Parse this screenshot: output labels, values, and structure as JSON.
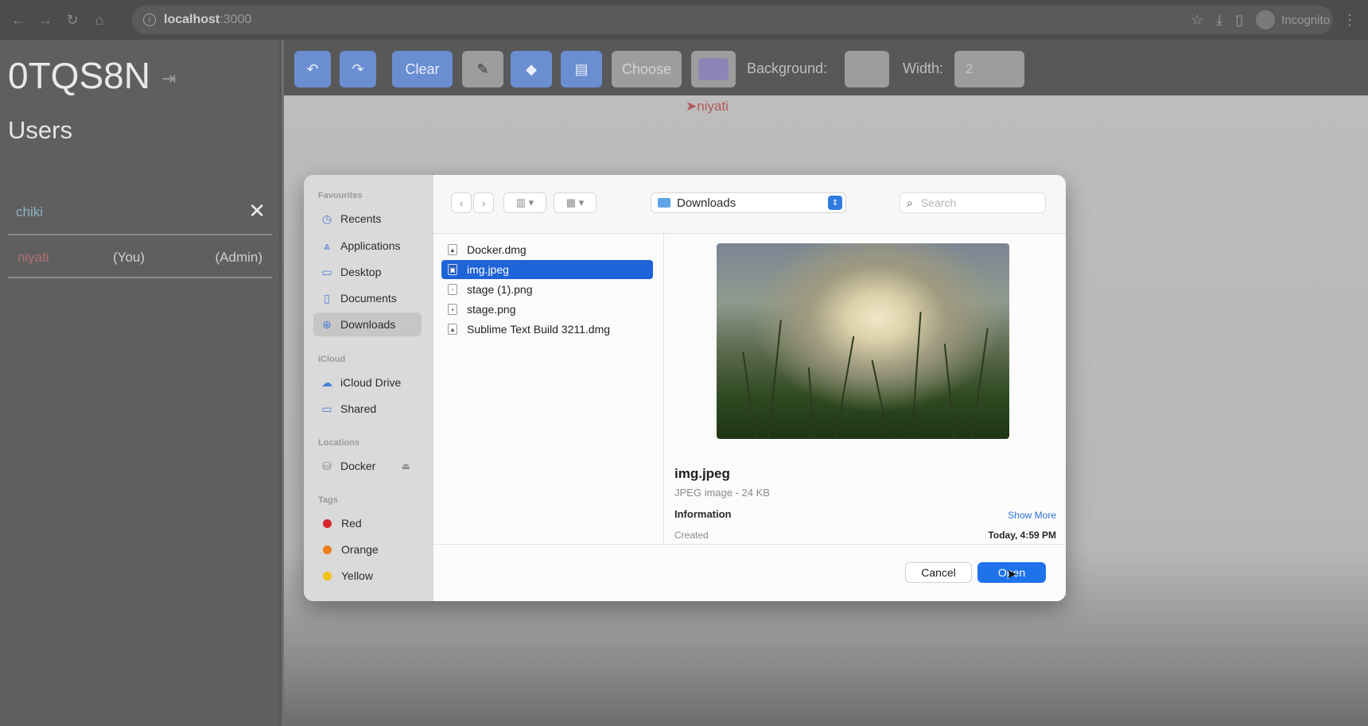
{
  "browser": {
    "host": "localhost",
    "port": ":3000",
    "profile_label": "Incognito"
  },
  "sidebar": {
    "room_code": "0TQS8N",
    "users_title": "Users",
    "search_value": "chiki",
    "users": [
      {
        "name": "niyati",
        "you": "(You)",
        "role": "(Admin)"
      }
    ]
  },
  "toolbar": {
    "clear_label": "Clear",
    "choose_label": "Choose",
    "background_label": "Background:",
    "width_label": "Width:",
    "width_value": "2",
    "pen_color": "#8b86b5"
  },
  "canvas": {
    "cursor_label": "niyati"
  },
  "dialog": {
    "favourites_title": "Favourites",
    "favourites": [
      "Recents",
      "Applications",
      "Desktop",
      "Documents",
      "Downloads"
    ],
    "icloud_title": "iCloud",
    "icloud": [
      "iCloud Drive",
      "Shared"
    ],
    "locations_title": "Locations",
    "locations": [
      "Docker"
    ],
    "tags_title": "Tags",
    "tags": [
      {
        "name": "Red",
        "color": "#d8262f"
      },
      {
        "name": "Orange",
        "color": "#ef7d1c"
      },
      {
        "name": "Yellow",
        "color": "#f1c20e"
      }
    ],
    "location": "Downloads",
    "search_placeholder": "Search",
    "files": [
      "Docker.dmg",
      "img.jpeg",
      "stage (1).png",
      "stage.png",
      "Sublime Text Build 3211.dmg"
    ],
    "selected_file": "img.jpeg",
    "preview": {
      "name": "img.jpeg",
      "kind": "JPEG image - 24 KB",
      "information": "Information",
      "show_more": "Show More",
      "created_label": "Created",
      "created_value": "Today, 4:59 PM"
    },
    "cancel_label": "Cancel",
    "open_label": "Open"
  }
}
